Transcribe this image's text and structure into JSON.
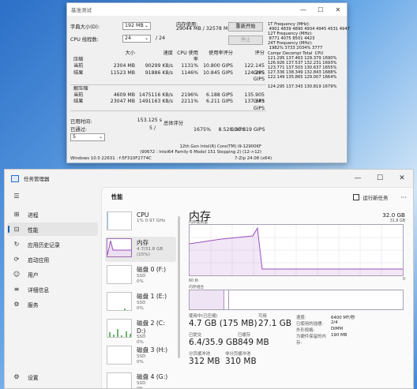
{
  "bench": {
    "title": "基准测试",
    "dict_label": "字典大小(D):",
    "dict_value": "192 MB",
    "mem_usage_label": "内存使用:",
    "mem_usage_value": "29044 MB / 32578 MB",
    "restart_btn": "重新开始",
    "threads_label": "CPU 线程数:",
    "threads_value": "24",
    "threads_total": "/ 24",
    "stop_btn": "停止",
    "headers": [
      "大小",
      "速度",
      "CPU 使用率",
      "使用率评分",
      "评分"
    ],
    "compress_label": "压缩",
    "decompress_label": "解压缩",
    "compress_rows": [
      {
        "label": "当前",
        "size": "2304 MB",
        "speed": "90299 KB/s",
        "cpu": "1131%",
        "rating_usage": "10.800 GIPS",
        "rating": "122.145 GIPS"
      },
      {
        "label": "结果",
        "size": "11523 MB",
        "speed": "91886 KB/s",
        "cpu": "1146%",
        "rating_usage": "10.845 GIPS",
        "rating": "124.295 GIPS"
      }
    ],
    "decompress_rows": [
      {
        "label": "当前",
        "size": "4609 MB",
        "speed": "1475116 KB/s",
        "cpu": "2196%",
        "rating_usage": "6.188 GIPS",
        "rating": "135.905 GIPS"
      },
      {
        "label": "结果",
        "size": "23047 MB",
        "speed": "1491163 KB/s",
        "cpu": "2211%",
        "rating_usage": "6.211 GIPS",
        "rating": "137.343 GIPS"
      }
    ],
    "elapsed_label": "已用时间:",
    "elapsed_value": "153.125 s",
    "passes_label": "已通过:",
    "passes_value": "5 /",
    "passes_select": "5",
    "total_label": "总体评分",
    "total_cpu": "1675%",
    "total_usage": "8.528 GIPS",
    "total_rating": "130.819 GIPS",
    "cpu_name_1": "12th Gen Intel(R) Core(TM) i9-12900KF",
    "cpu_name_2": "(90672 : Intel64 Family 6 Model 151 Stepping 2) (12->12)",
    "os_line": "Windows 10.0 22631 : f:5F310F2774C",
    "zip_version": "7-Zip 24.08 (x64)",
    "log_text": "1T Frequency (MHz):\n 4901 4839 4890 4934 4945 4531 4947\n12T Frequency (MHz):\n 8771 4075 8501 4423\n24T Frequency (MHz):\n 1982% 3733 2034% 3777\nCompr Decompr Total  CPU\n121.295 137.463 129.379 1690%\n126.926 137.537 132.231 1693%\n123.771 137.503 130.637 1655%\n127.336 138.349 132.843 1688%\n122.149 135.865 129.007 1664%\n\n124.295 137.343 130.819 1679%"
  },
  "tm": {
    "title": "任务管理器",
    "sidebar": [
      {
        "icon": "☰",
        "label": "",
        "name": "menu"
      },
      {
        "icon": "⊞",
        "label": "进程",
        "name": "processes"
      },
      {
        "icon": "⊡",
        "label": "性能",
        "name": "performance"
      },
      {
        "icon": "↻",
        "label": "应用历史记录",
        "name": "app-history"
      },
      {
        "icon": "⟳",
        "label": "启动应用",
        "name": "startup"
      },
      {
        "icon": "☺",
        "label": "用户",
        "name": "users"
      },
      {
        "icon": "≡",
        "label": "详细信息",
        "name": "details"
      },
      {
        "icon": "⚙",
        "label": "服务",
        "name": "services"
      }
    ],
    "settings_label": "设置",
    "page_title": "性能",
    "run_task": "运行新任务",
    "more": "···",
    "resources": [
      {
        "name": "CPU",
        "sub1": "1% 0.97 GHz",
        "sub2": ""
      },
      {
        "name": "内存",
        "sub1": "4.7/31.8 GB (15%)",
        "sub2": ""
      },
      {
        "name": "磁盘 0 (F:)",
        "sub1": "SSD",
        "sub2": "0%"
      },
      {
        "name": "磁盘 1 (E:)",
        "sub1": "SSD",
        "sub2": "0%"
      },
      {
        "name": "磁盘 2 (C: D:)",
        "sub1": "SSD",
        "sub2": "0%"
      },
      {
        "name": "磁盘 3 (H:)",
        "sub1": "SSD",
        "sub2": "0%"
      },
      {
        "name": "磁盘 4 (G:)",
        "sub1": "SSD",
        "sub2": "0%"
      }
    ],
    "memory": {
      "title": "内存",
      "total": "32.0 GB",
      "usage_label": "内存使用量",
      "max_label": "31.8 GB",
      "time_label": "60 秒",
      "zero_label": "0",
      "composition_label": "内存组合",
      "stats": {
        "in_use_label": "使用中(已压缩)",
        "in_use_value": "4.7 GB (175 MB)",
        "available_label": "可用",
        "available_value": "27.1 GB",
        "committed_label": "已提交",
        "committed_value": "6.4/35.9 GB",
        "cached_label": "已缓存",
        "cached_value": "849 MB",
        "paged_label": "分页缓冲池",
        "paged_value": "312 MB",
        "nonpaged_label": "非分页缓冲池",
        "nonpaged_value": "310 MB"
      },
      "right": [
        {
          "k": "速度:",
          "v": "6400 MT/秒"
        },
        {
          "k": "已使用的插槽:",
          "v": "2/4"
        },
        {
          "k": "外形规格:",
          "v": "DIMM"
        },
        {
          "k": "为硬件保留的内存:",
          "v": "190 MB"
        }
      ]
    }
  }
}
